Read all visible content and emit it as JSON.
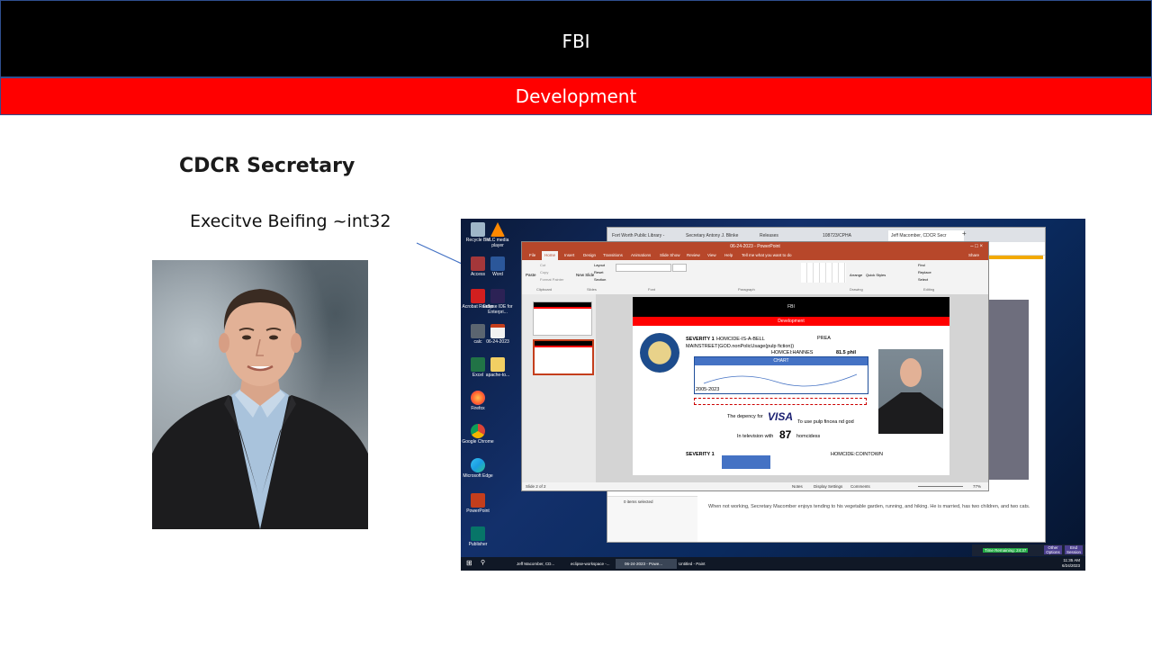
{
  "slide": {
    "top_bar_title": "FBI",
    "sub_bar_title": "Development",
    "heading": "CDCR Secretary",
    "subheading": "Execitve Beifing ~int32",
    "colors": {
      "top_bar": "#000000",
      "sub_bar": "#ff0000",
      "arrow": "#4472c4"
    }
  },
  "screenshot": {
    "desktop_icons": [
      {
        "label": "Recycle Bin",
        "icon": "recycle-bin-icon"
      },
      {
        "label": "VLC media player",
        "icon": "vlc-icon"
      },
      {
        "label": "Access",
        "icon": "access-icon"
      },
      {
        "label": "Word",
        "icon": "word-icon"
      },
      {
        "label": "Acrobat Reader",
        "icon": "acrobat-icon"
      },
      {
        "label": "Eclipse IDE for Enterpri...",
        "icon": "eclipse-icon"
      },
      {
        "label": "calc",
        "icon": "calc-icon"
      },
      {
        "label": "06-24-2023",
        "icon": "pptx-file-icon"
      },
      {
        "label": "Excel",
        "icon": "excel-icon"
      },
      {
        "label": "apache-to...",
        "icon": "folder-icon"
      },
      {
        "label": "Firefox",
        "icon": "firefox-icon"
      },
      {
        "label": "Google Chrome",
        "icon": "chrome-icon"
      },
      {
        "label": "Microsoft Edge",
        "icon": "edge-icon"
      },
      {
        "label": "PowerPoint",
        "icon": "powerpoint-icon"
      },
      {
        "label": "Publisher",
        "icon": "publisher-icon"
      }
    ],
    "browser": {
      "tabs": [
        "Fort Worth Public Library -",
        "Secretary Antony J. Blinke",
        "Releases",
        "108723/CPHA",
        "Jeff Macomber, CDCR Secr"
      ],
      "bio_text": "When not working, Secretary Macomber enjoys tending to his vegetable garden, running, and hiking. He is married, has two children, and two cats."
    },
    "powerpoint": {
      "window_title": "06-24-2023 - PowerPoint",
      "search_hint": "Tell me what you want to do",
      "menu": [
        "File",
        "Home",
        "Insert",
        "Design",
        "Transitions",
        "Animations",
        "Slide Show",
        "Review",
        "View",
        "Help"
      ],
      "ribbon_groups": [
        "Clipboard",
        "Slides",
        "Font",
        "Paragraph",
        "Drawing",
        "Editing"
      ],
      "ribbon_items": {
        "paste": "Paste",
        "cut": "Cut",
        "copy": "Copy",
        "format_painter": "Format Painter",
        "new_slide": "New Slide",
        "layout": "Layout",
        "reset": "Reset",
        "section": "Section",
        "arrange": "Arrange",
        "quick_styles": "Quick Styles",
        "find": "Find",
        "replace": "Replace",
        "select": "Select",
        "share": "Share"
      },
      "status": {
        "slide": "Slide 2 of 2",
        "notes": "Notes",
        "display": "Display Settings",
        "comments": "Comments",
        "zoom": "77%"
      },
      "inner_slide": {
        "top_bar": "FBI",
        "sub_bar": "Development",
        "line1_bold": "SEVERITY 1",
        "line1": "HOMCIDE-IS-A-BELL",
        "prea": "PREA",
        "line2": "MAINSTREET(GOD.nonPolicUsage(pulp fiction))",
        "line3": "HOMCEI:HANNES",
        "line3b": "81.5 phil",
        "chart_label": "CHART",
        "years": "2005-2023",
        "depency": "The depency for",
        "visa": "VISA",
        "pulp": "To use pulp fincea nd god",
        "tv": "In television with",
        "num": "87",
        "homcidess": "homcidess",
        "severity2": "SEVERITY 1",
        "cointown": "HOMCIDE:COINTOWN"
      }
    },
    "explorer_status": "0 items selected",
    "taskbar": {
      "items": [
        "Jeff Macomber, CD...",
        "eclipse-workspace -...",
        "06-24-2023 - Powe...",
        "Untitled - Paint"
      ],
      "time": "11:35 AM",
      "date": "6/24/2023"
    },
    "session": {
      "time_remaining": "Time Remaining: 24:37",
      "other_options": "Other Options",
      "end_session": "End Session"
    }
  }
}
